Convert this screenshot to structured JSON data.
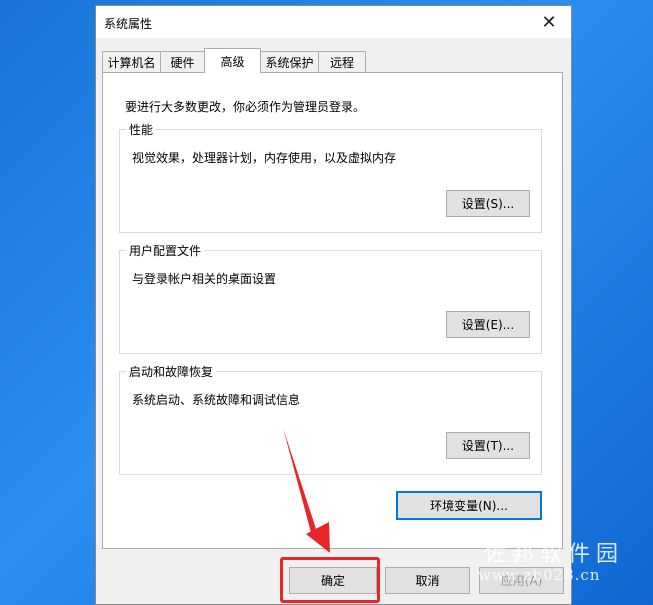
{
  "window": {
    "title": "系统属性",
    "close_glyph": "✕"
  },
  "tabs": [
    {
      "label": "计算机名"
    },
    {
      "label": "硬件"
    },
    {
      "label": "高级",
      "active": true
    },
    {
      "label": "系统保护"
    },
    {
      "label": "远程"
    }
  ],
  "advanced": {
    "admin_note": "要进行大多数更改，你必须作为管理员登录。",
    "performance": {
      "title": "性能",
      "description": "视觉效果，处理器计划，内存使用，以及虚拟内存",
      "button": "设置(S)..."
    },
    "user_profiles": {
      "title": "用户配置文件",
      "description": "与登录帐户相关的桌面设置",
      "button": "设置(E)..."
    },
    "startup_recovery": {
      "title": "启动和故障恢复",
      "description": "系统启动、系统故障和调试信息",
      "button": "设置(T)..."
    },
    "env_button": "环境变量(N)..."
  },
  "footer": {
    "ok": "确定",
    "cancel": "取消",
    "apply": "应用(A)"
  },
  "watermark": {
    "cn": "佐邦软件园",
    "url": "www.zb028.cn"
  },
  "colors": {
    "highlight": "#e8262a",
    "focus": "#0078d7"
  }
}
